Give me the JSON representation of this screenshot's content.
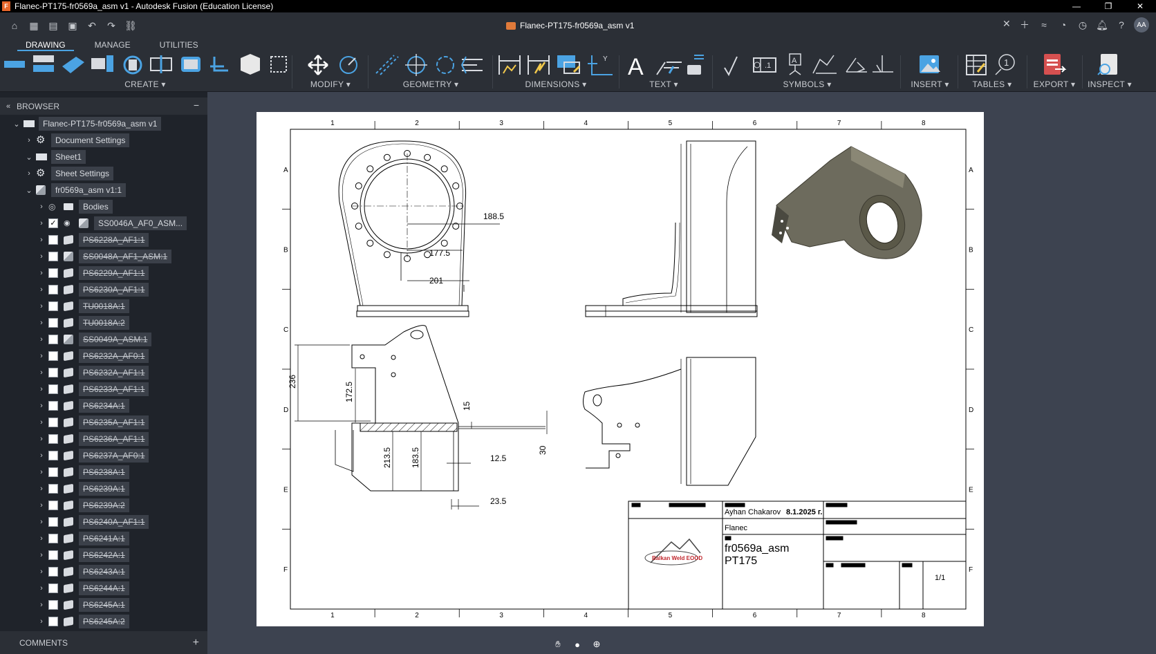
{
  "window": {
    "title": "Flanec-PT175-fr0569a_asm v1 - Autodesk Fusion (Education License)",
    "app_icon": "F"
  },
  "document": {
    "tab_title": "Flanec-PT175-fr0569a_asm v1"
  },
  "user": {
    "initials": "AA"
  },
  "ribbon": {
    "tabs": [
      {
        "label": "DRAWING",
        "active": true
      },
      {
        "label": "MANAGE",
        "active": false
      },
      {
        "label": "UTILITIES",
        "active": false
      }
    ],
    "groups": {
      "create": "CREATE ▾",
      "modify": "MODIFY ▾",
      "geometry": "GEOMETRY ▾",
      "dimensions": "DIMENSIONS ▾",
      "text": "TEXT ▾",
      "symbols": "SYMBOLS ▾",
      "insert": "INSERT ▾",
      "tables": "TABLES ▾",
      "export": "EXPORT ▾",
      "inspect": "INSPECT ▾"
    }
  },
  "browser": {
    "title": "BROWSER",
    "items": [
      {
        "label": "Flanec-PT175-fr0569a_asm v1",
        "level": 0,
        "type": "doc",
        "struck": false
      },
      {
        "label": "Document Settings",
        "level": 1,
        "type": "gear",
        "struck": false
      },
      {
        "label": "Sheet1",
        "level": 1,
        "type": "sheet",
        "struck": false
      },
      {
        "label": "Sheet Settings",
        "level": 2,
        "type": "gear",
        "struck": false
      },
      {
        "label": "fr0569a_asm v1:1",
        "level": 2,
        "type": "asm",
        "struck": false
      },
      {
        "label": "Bodies",
        "level": 3,
        "type": "folder",
        "struck": false
      },
      {
        "label": "SS0046A_AF0_ASM...",
        "level": 3,
        "type": "asm",
        "struck": false
      },
      {
        "label": "PS6228A_AF1:1",
        "level": 3,
        "type": "part",
        "struck": true
      },
      {
        "label": "SS0048A_AF1_ASM:1",
        "level": 3,
        "type": "asm",
        "struck": true
      },
      {
        "label": "PS6229A_AF1:1",
        "level": 3,
        "type": "part",
        "struck": true
      },
      {
        "label": "PS6230A_AF1:1",
        "level": 3,
        "type": "part",
        "struck": true
      },
      {
        "label": "TU0018A:1",
        "level": 3,
        "type": "part",
        "struck": true
      },
      {
        "label": "TU0018A:2",
        "level": 3,
        "type": "part",
        "struck": true
      },
      {
        "label": "SS0049A_ASM:1",
        "level": 3,
        "type": "asm",
        "struck": true
      },
      {
        "label": "PS6232A_AF0:1",
        "level": 3,
        "type": "part",
        "struck": true
      },
      {
        "label": "PS6232A_AF1:1",
        "level": 3,
        "type": "part",
        "struck": true
      },
      {
        "label": "PS6233A_AF1:1",
        "level": 3,
        "type": "part",
        "struck": true
      },
      {
        "label": "PS6234A:1",
        "level": 3,
        "type": "part",
        "struck": true
      },
      {
        "label": "PS6235A_AF1:1",
        "level": 3,
        "type": "part",
        "struck": true
      },
      {
        "label": "PS6236A_AF1:1",
        "level": 3,
        "type": "part",
        "struck": true
      },
      {
        "label": "PS6237A_AF0:1",
        "level": 3,
        "type": "part",
        "struck": true
      },
      {
        "label": "PS6238A:1",
        "level": 3,
        "type": "part",
        "struck": true
      },
      {
        "label": "PS6239A:1",
        "level": 3,
        "type": "part",
        "struck": true
      },
      {
        "label": "PS6239A:2",
        "level": 3,
        "type": "part",
        "struck": true
      },
      {
        "label": "PS6240A_AF1:1",
        "level": 3,
        "type": "part",
        "struck": true
      },
      {
        "label": "PS6241A:1",
        "level": 3,
        "type": "part",
        "struck": true
      },
      {
        "label": "PS6242A:1",
        "level": 3,
        "type": "part",
        "struck": true
      },
      {
        "label": "PS6243A:1",
        "level": 3,
        "type": "part",
        "struck": true
      },
      {
        "label": "PS6244A:1",
        "level": 3,
        "type": "part",
        "struck": true
      },
      {
        "label": "PS6245A:1",
        "level": 3,
        "type": "part",
        "struck": true
      },
      {
        "label": "PS6245A:2",
        "level": 3,
        "type": "part",
        "struck": true
      }
    ]
  },
  "comments": {
    "title": "COMMENTS"
  },
  "drawing": {
    "zone_cols": [
      "1",
      "2",
      "3",
      "4",
      "5",
      "6",
      "7",
      "8"
    ],
    "zone_rows": [
      "A",
      "B",
      "C",
      "D",
      "E",
      "F"
    ],
    "dims": {
      "d188": "188.5",
      "d177": "177.5",
      "d201": "201",
      "d236": "236",
      "d172": "172.5",
      "d15": "15",
      "d30": "30",
      "d213": "213.5",
      "d183": "183.5",
      "d12": "12.5",
      "d23": "23.5"
    },
    "title_block": {
      "author": "Ayhan Chakarov",
      "date": "8.1.2025 г.",
      "name": "Flanec",
      "part_line1": "fr0569a_asm",
      "part_line2": "PT175",
      "sheet": "1/1",
      "logo_text": "Balkan Weld EOOD"
    }
  }
}
